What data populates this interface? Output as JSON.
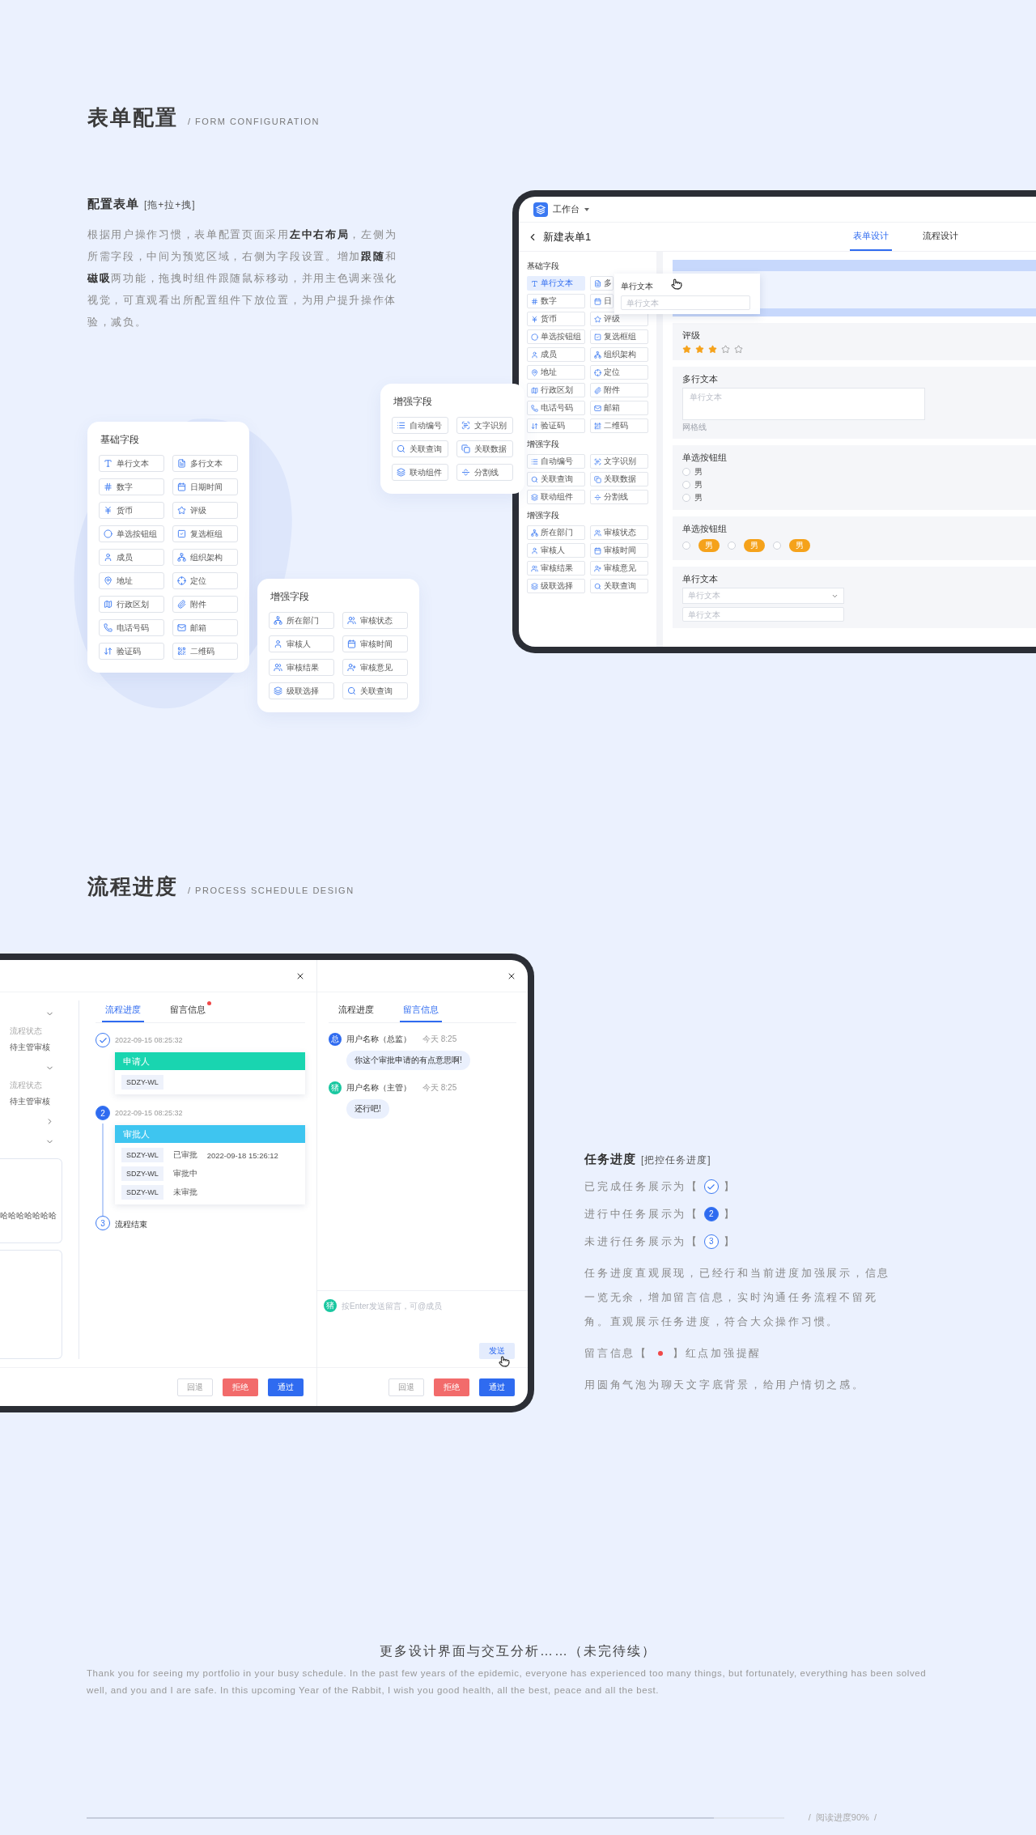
{
  "form_section": {
    "title": "表单配置",
    "subtitle": "/ FORM CONFIGURATION",
    "heading": "配置表单",
    "heading_note": "[拖+拉+拽]",
    "description": "根据用户操作习惯，表单配置页面采用**左中右布局**，左侧为所需字段，中间为预览区域，右侧为字段设置。增加**跟随**和**磁吸**两功能，拖拽时组件跟随鼠标移动，并用主色调来强化视觉，可直观看出所配置组件下放位置，为用户提升操作体验，减负。"
  },
  "field_cards": [
    {
      "kind": "basic",
      "title": "基础字段",
      "fields": [
        "单行文本",
        "多行文本",
        "数字",
        "日期时间",
        "货币",
        "评级",
        "单选按钮组",
        "复选框组",
        "成员",
        "组织架构",
        "地址",
        "定位",
        "行政区划",
        "附件",
        "电话号码",
        "邮箱",
        "验证码",
        "二维码"
      ]
    },
    {
      "kind": "workflow",
      "title": "增强字段",
      "fields": [
        "所在部门",
        "审核状态",
        "审核人",
        "审核时间",
        "审核结果",
        "审核意见",
        "级联选择",
        "关联查询"
      ]
    },
    {
      "kind": "advanced",
      "title": "增强字段",
      "fields": [
        "自动编号",
        "文字识别",
        "关联查询",
        "关联数据",
        "联动组件",
        "分割线"
      ]
    }
  ],
  "form_designer": {
    "app_name": "工作台",
    "form_title": "新建表单1",
    "tabs": [
      {
        "label": "表单设计",
        "selected": true
      },
      {
        "label": "流程设计",
        "selected": false
      }
    ],
    "sidebar_groups": [
      {
        "kind": "basic",
        "title": "基础字段",
        "items": [
          {
            "label": "单行文本",
            "selected": true
          },
          {
            "label": "多",
            "selected": false
          },
          {
            "label": "数字",
            "selected": false
          },
          {
            "label": "日",
            "selected": false
          },
          {
            "label": "货币",
            "selected": false
          },
          {
            "label": "评级",
            "selected": false
          },
          {
            "label": "单选按钮组",
            "selected": false
          },
          {
            "label": "复选框组",
            "selected": false
          },
          {
            "label": "成员",
            "selected": false
          },
          {
            "label": "组织架构",
            "selected": false
          },
          {
            "label": "地址",
            "selected": false
          },
          {
            "label": "定位",
            "selected": false
          },
          {
            "label": "行政区划",
            "selected": false
          },
          {
            "label": "附件",
            "selected": false
          },
          {
            "label": "电话号码",
            "selected": false
          },
          {
            "label": "邮箱",
            "selected": false
          },
          {
            "label": "验证码",
            "selected": false
          },
          {
            "label": "二维码",
            "selected": false
          }
        ]
      },
      {
        "kind": "advanced",
        "title": "增强字段",
        "items": [
          {
            "label": "自动编号",
            "selected": false
          },
          {
            "label": "文字识别",
            "selected": false
          },
          {
            "label": "关联查询",
            "selected": false
          },
          {
            "label": "关联数据",
            "selected": false
          },
          {
            "label": "联动组件",
            "selected": false
          },
          {
            "label": "分割线",
            "selected": false
          }
        ]
      },
      {
        "kind": "workflow",
        "title": "增强字段",
        "items": [
          {
            "label": "所在部门",
            "selected": false
          },
          {
            "label": "审核状态",
            "selected": false
          },
          {
            "label": "审核人",
            "selected": false
          },
          {
            "label": "审核时间",
            "selected": false
          },
          {
            "label": "审核结果",
            "selected": false
          },
          {
            "label": "审核意见",
            "selected": false
          },
          {
            "label": "级联选择",
            "selected": false
          },
          {
            "label": "关联查询",
            "selected": false
          }
        ]
      }
    ],
    "drag_ghost": {
      "label": "单行文本",
      "placeholder": "单行文本"
    },
    "fields": [
      {
        "kind": "rating",
        "label": "评级",
        "stars": 3
      },
      {
        "kind": "textarea",
        "label": "多行文本",
        "placeholder": "单行文本",
        "hint": "网格线"
      },
      {
        "kind": "radio",
        "label": "单选按钮组",
        "options": [
          {
            "label": "男",
            "selected": false
          },
          {
            "label": "男",
            "selected": false
          },
          {
            "label": "男",
            "selected": false
          }
        ]
      },
      {
        "kind": "tag_radio",
        "label": "单选按钮组",
        "options": [
          {
            "label": "男",
            "selected": false
          },
          {
            "label": "男",
            "selected": false
          },
          {
            "label": "男",
            "selected": false
          }
        ]
      },
      {
        "kind": "select_input",
        "label": "单行文本",
        "placeholder": "单行文本",
        "input_placeholder": "单行文本"
      }
    ]
  },
  "process_section": {
    "title": "流程进度",
    "subtitle": "/ PROCESS SCHEDULE DESIGN"
  },
  "process_dialog": {
    "side_panel": [
      {
        "kind": "collapse",
        "expanded": true
      },
      {
        "kind": "status",
        "label": "流程状态",
        "value": "待主管审核"
      },
      {
        "kind": "collapse",
        "expanded": true
      },
      {
        "kind": "status",
        "label": "流程状态",
        "value": "待主管审核"
      },
      {
        "kind": "collapse",
        "expanded": false
      },
      {
        "kind": "collapse",
        "expanded": true
      },
      {
        "kind": "note",
        "text": "哈哈哈哈哈哈哈"
      },
      {
        "kind": "note"
      }
    ],
    "tabs": [
      {
        "label": "流程进度",
        "selected": true,
        "dot": false
      },
      {
        "label": "留言信息",
        "selected": false,
        "dot": true
      }
    ],
    "steps": [
      {
        "kind": "done",
        "time": "2022-09-15 08:25:32",
        "role": "申请人",
        "color": "#19d5b0",
        "rows": [
          {
            "user": "SDZY-WL"
          }
        ]
      },
      {
        "kind": "active",
        "number": "2",
        "time": "2022-09-15 08:25:32",
        "role": "审批人",
        "color": "#3ec5f0",
        "rows": [
          {
            "user": "SDZY-WL",
            "status": "已审批",
            "time": "2022-09-18 15:26:12"
          },
          {
            "user": "SDZY-WL",
            "status": "审批中"
          },
          {
            "user": "SDZY-WL",
            "status": "未审批"
          }
        ]
      },
      {
        "kind": "pending",
        "number": "3",
        "label": "流程结束"
      }
    ],
    "buttons": [
      {
        "label": "回退",
        "kind": "default"
      },
      {
        "label": "拒绝",
        "kind": "danger"
      },
      {
        "label": "通过",
        "kind": "primary"
      }
    ]
  },
  "chat_dialog": {
    "tabs": [
      {
        "label": "流程进度",
        "selected": false
      },
      {
        "label": "留言信息",
        "selected": true
      }
    ],
    "messages": [
      {
        "avatar": "总",
        "color": "#2f6bf0",
        "name": "用户名称（总监）",
        "time": "今天 8:25",
        "text": "你这个审批申请的有点意思啊!"
      },
      {
        "avatar": "猪",
        "color": "#19c7a0",
        "name": "用户名称（主管）",
        "time": "今天 8:25",
        "text": "还行吧!"
      }
    ],
    "composer": {
      "avatar": "猪",
      "color": "#19c7a0",
      "placeholder": "按Enter发送留言，可@成员",
      "send": "发送"
    },
    "buttons": [
      {
        "label": "回退",
        "kind": "default"
      },
      {
        "label": "拒绝",
        "kind": "danger"
      },
      {
        "label": "通过",
        "kind": "primary"
      }
    ]
  },
  "task_section": {
    "heading": "任务进度",
    "heading_note": "[把控任务进度]",
    "lines": [
      {
        "kind": "done",
        "prefix": "已完成任务展示为【",
        "suffix": "】"
      },
      {
        "kind": "active",
        "prefix": "进行中任务展示为【",
        "number": "2",
        "suffix": "】"
      },
      {
        "kind": "pending",
        "prefix": "未进行任务展示为【",
        "number": "3",
        "suffix": "】"
      },
      {
        "kind": "text",
        "text": "任务进度直观展现，已经行和当前进度加强展示，信息一览无余，增加留言信息，实时沟通任务流程不留死角。直观展示任务进度，符合大众操作习惯。"
      },
      {
        "kind": "dot",
        "prefix": "留言信息【",
        "suffix": "】红点加强提醒"
      },
      {
        "kind": "text",
        "text": "用圆角气泡为聊天文字底背景，给用户情切之感。"
      }
    ]
  },
  "footer": {
    "heading": "更多设计界面与交互分析……（未完待续）",
    "text": "Thank you for seeing my portfolio in your busy schedule. In the past few years of the epidemic, everyone has experienced too many things, but fortunately, everything has been solved well, and you and I are safe. In this upcoming Year of the Rabbit, I wish you good health, all the best, peace and all the best.",
    "progress": "/  阅读进度90%  /",
    "level": 0.9
  }
}
